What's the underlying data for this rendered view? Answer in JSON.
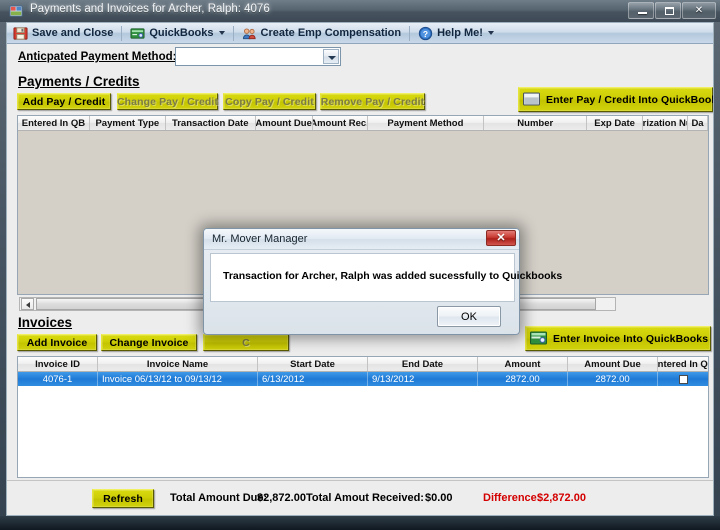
{
  "window": {
    "title": "Payments and Invoices for Archer, Ralph: 4076",
    "icon": "application-icon",
    "buttons": {
      "minimize": "minimize-button",
      "maximize": "maximize-button",
      "close_glyph": "✕"
    }
  },
  "toolbar": {
    "items": [
      {
        "label": "Save and Close",
        "icon": "save-icon",
        "dropdown": false
      },
      {
        "label": "QuickBooks",
        "icon": "quickbooks-icon",
        "dropdown": true
      },
      {
        "label": "Create Emp Compensation",
        "icon": "people-icon",
        "dropdown": false
      },
      {
        "label": "Help Me!",
        "icon": "help-icon",
        "dropdown": true
      }
    ]
  },
  "form": {
    "anticipated_label": "Anticpated Payment Method:",
    "anticipated_value": "",
    "anticipated_placeholder": ""
  },
  "payments": {
    "heading": "Payments / Credits",
    "buttons": [
      {
        "label": "Add Pay / Credit",
        "enabled": true
      },
      {
        "label": "Change Pay / Credit",
        "enabled": false
      },
      {
        "label": "Copy Pay / Credit",
        "enabled": false
      },
      {
        "label": "Remove Pay / Credit",
        "enabled": false
      }
    ],
    "qb_button": {
      "label": "Enter Pay / Credit Into QuickBooks",
      "icon": "quickbooks-icon"
    },
    "columns": [
      "Entered In QB",
      "Payment Type",
      "Transaction Date",
      "Amount Due",
      "Amount Rec.",
      "Payment Method",
      "Number",
      "Exp Date",
      "Authorization Number",
      "Da"
    ],
    "rows": []
  },
  "invoices": {
    "heading": "Invoices",
    "buttons": [
      {
        "label": "Add Invoice",
        "enabled": true
      },
      {
        "label": "Change Invoice",
        "enabled": true
      },
      {
        "label": "C",
        "enabled": false
      }
    ],
    "qb_button": {
      "label": "Enter Invoice Into QuickBooks",
      "icon": "quickbooks-icon"
    },
    "columns": [
      "Invoice ID",
      "Invoice Name",
      "Start Date",
      "End Date",
      "Amount",
      "Amount Due",
      "Entered In QB"
    ],
    "rows": [
      {
        "invoice_id": "4076-1",
        "invoice_name": "Invoice 06/13/12 to 09/13/12",
        "start_date": "6/13/2012",
        "end_date": "9/13/2012",
        "amount": "2872.00",
        "amount_due": "2872.00",
        "entered_in_qb": false,
        "selected": true
      }
    ]
  },
  "status": {
    "refresh_label": "Refresh",
    "total_due_label": "Total Amount Due:",
    "total_due_value": "$2,872.00",
    "total_received_label": "Total Amout Received:",
    "total_received_value": "$0.00",
    "difference_label": "Difference:",
    "difference_value": "$2,872.00"
  },
  "dialog": {
    "title": "Mr. Mover Manager",
    "message": "Transaction for Archer, Ralph was added sucessfully to Quickbooks",
    "ok_label": "OK",
    "close_glyph": "✕"
  },
  "colors": {
    "yellow_button": "#cdcd06",
    "selection_blue": "#2f8ddf",
    "difference_red": "#d40000",
    "title_bar": "#56646f"
  }
}
